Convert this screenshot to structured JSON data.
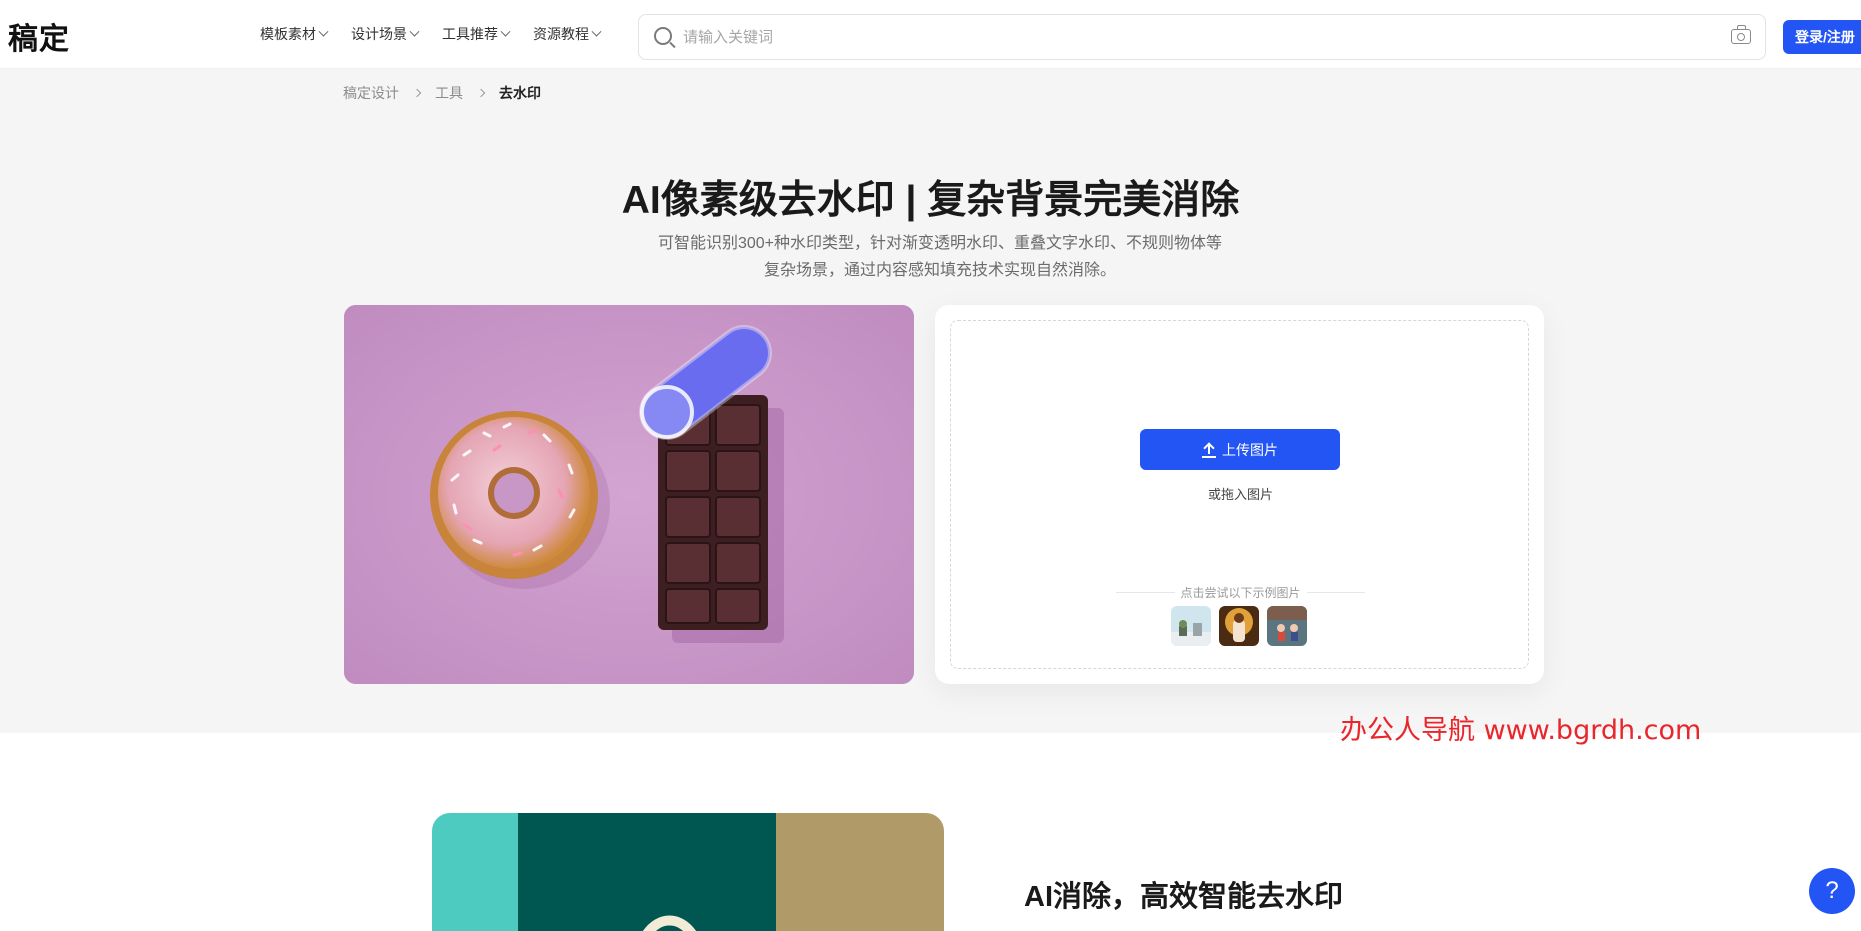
{
  "header": {
    "logo": "稿定",
    "nav": [
      {
        "label": "模板素材"
      },
      {
        "label": "设计场景"
      },
      {
        "label": "工具推荐"
      },
      {
        "label": "资源教程"
      }
    ],
    "search_placeholder": "请输入关键词",
    "login_label": "登录/注册"
  },
  "breadcrumb": {
    "items": [
      "稿定设计",
      "工具"
    ],
    "current": "去水印"
  },
  "hero": {
    "title": "AI像素级去水印 | 复杂背景完美消除",
    "desc_line1": "可智能识别300+种水印类型，针对渐变透明水印、重叠文字水印、不规则物体等",
    "desc_line2": "复杂场景，通过内容感知填充技术实现自然消除。"
  },
  "upload": {
    "button_label": "上传图片",
    "drag_text": "或拖入图片",
    "try_label": "点击尝试以下示例图片"
  },
  "watermark_text": "办公人导航 www.bgrdh.com",
  "feature": {
    "title": "AI消除，高效智能去水印"
  },
  "help": {
    "label": "?"
  },
  "colors": {
    "accent": "#2354f4",
    "hero_bg": "#f5f5f5",
    "watermark": "#e8262b"
  }
}
